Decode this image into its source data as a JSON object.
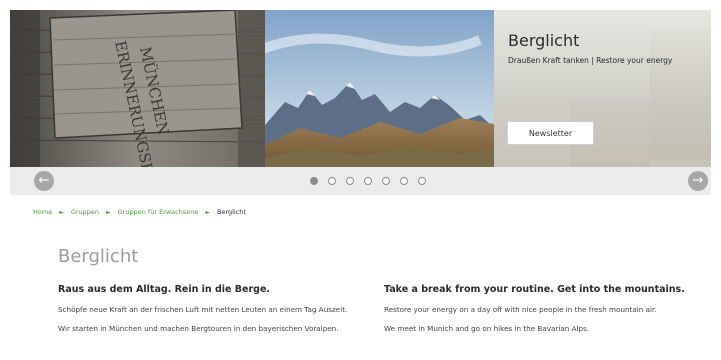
{
  "hero": {
    "title": "Berglicht",
    "subtitle": "Draußen Kraft tanken | Restore your energy",
    "newsletter_label": "Newsletter",
    "sign_text_line1": "MÜNCHEN",
    "sign_text_line2": "ERINNERUNGSHÜTTE"
  },
  "slider": {
    "prev_label": "←",
    "next_label": "→",
    "dot_count": 7,
    "active_index": 0
  },
  "breadcrumb": {
    "items": [
      "Home",
      "Gruppen",
      "Gruppen für Erwachsene"
    ],
    "separator": "►",
    "current": "Berglicht"
  },
  "main": {
    "title": "Berglicht",
    "german": {
      "heading": "Raus aus dem Alltag. Rein in die Berge.",
      "paragraphs": [
        "Schöpfe neue Kraft an der frischen Luft mit netten Leuten an einem Tag Auszeit.",
        "Wir starten in München und machen Bergtouren in den bayerischen Voralpen."
      ]
    },
    "english": {
      "heading": "Take a break from your routine. Get into the mountains.",
      "paragraphs": [
        "Restore your energy on a day off with nice people in the fresh mountain air.",
        "We meet in Munich and go on hikes in the Bavarian Alps."
      ]
    }
  }
}
